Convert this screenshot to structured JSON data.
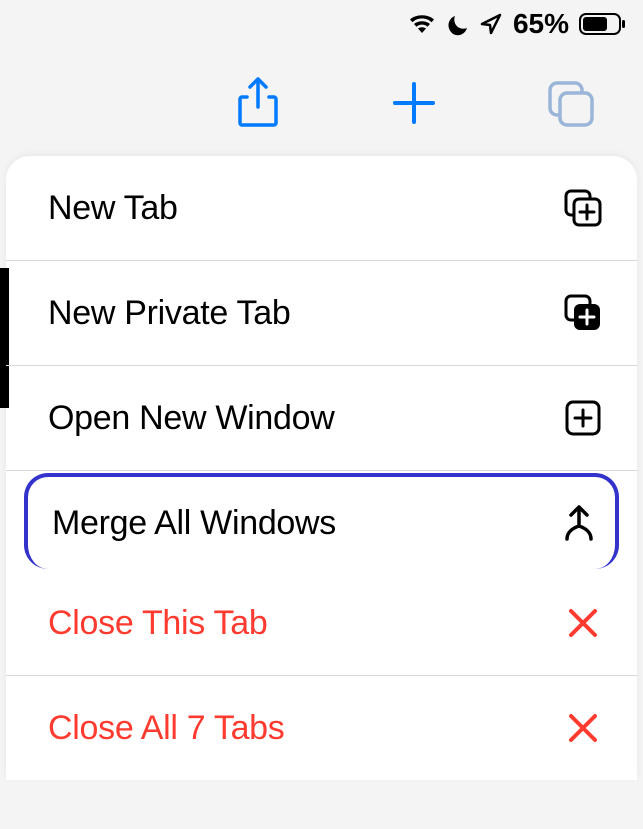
{
  "statusBar": {
    "batteryPercent": "65%"
  },
  "toolbar": {
    "share": "share",
    "newTab": "new-tab",
    "tabs": "tabs"
  },
  "menu": {
    "items": [
      {
        "label": "New Tab",
        "icon": "new-tab-icon",
        "destructive": false,
        "highlighted": false
      },
      {
        "label": "New Private Tab",
        "icon": "new-private-tab-icon",
        "destructive": false,
        "highlighted": false
      },
      {
        "label": "Open New Window",
        "icon": "new-window-icon",
        "destructive": false,
        "highlighted": false
      },
      {
        "label": "Merge All Windows",
        "icon": "merge-icon",
        "destructive": false,
        "highlighted": true
      },
      {
        "label": "Close This Tab",
        "icon": "close-icon",
        "destructive": true,
        "highlighted": false
      },
      {
        "label": "Close All 7 Tabs",
        "icon": "close-icon",
        "destructive": true,
        "highlighted": false
      }
    ]
  }
}
